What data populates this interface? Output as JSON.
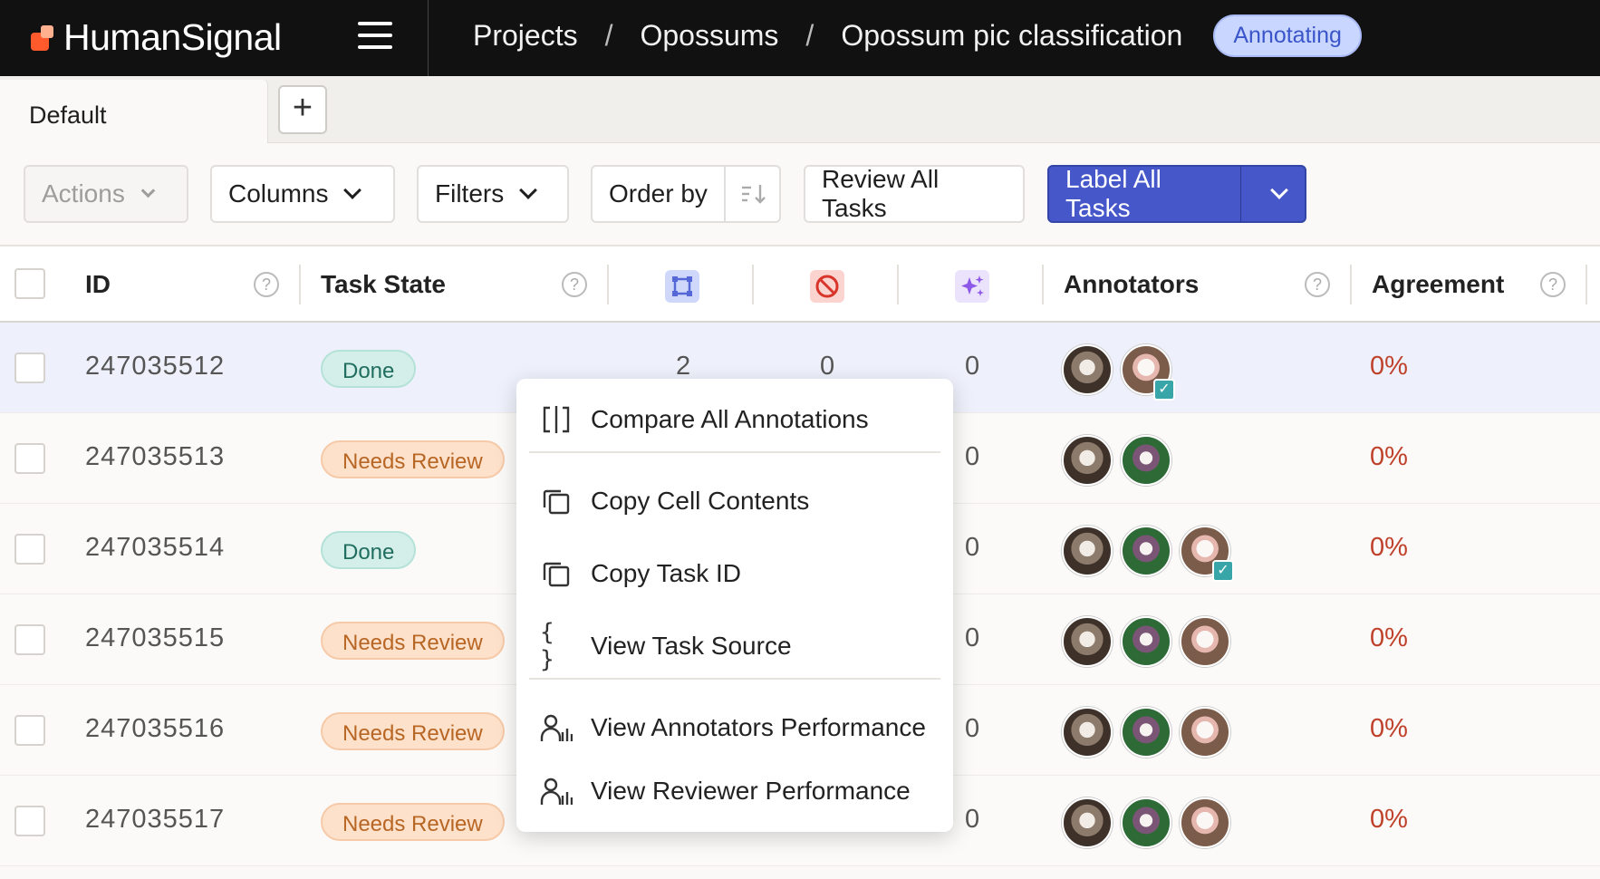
{
  "header": {
    "logo_text": "HumanSignal",
    "breadcrumbs": [
      "Projects",
      "Opossums",
      "Opossum pic classification"
    ],
    "separator": "/",
    "status": "Annotating"
  },
  "tabs": {
    "current": "Default",
    "add_label": "+"
  },
  "toolbar": {
    "actions": "Actions",
    "columns": "Columns",
    "filters": "Filters",
    "order_by": "Order by",
    "review_all": "Review All Tasks",
    "label_all": "Label All Tasks"
  },
  "table": {
    "headers": {
      "id": "ID",
      "task_state": "Task State",
      "annotators": "Annotators",
      "agreement": "Agreement"
    },
    "header_icons": [
      "annotations-count-icon",
      "cancelled-icon",
      "predictions-icon"
    ],
    "rows": [
      {
        "id": "247035512",
        "state": "Done",
        "state_kind": "done",
        "annotations": "2",
        "cancelled": "0",
        "predictions": "0",
        "avatars": [
          "a1",
          "a3"
        ],
        "agreement": "0%"
      },
      {
        "id": "247035513",
        "state": "Needs Review",
        "state_kind": "review",
        "annotations": "",
        "cancelled": "",
        "predictions": "0",
        "avatars": [
          "a1",
          "a2"
        ],
        "agreement": "0%"
      },
      {
        "id": "247035514",
        "state": "Done",
        "state_kind": "done",
        "annotations": "",
        "cancelled": "",
        "predictions": "0",
        "avatars": [
          "a1",
          "a2",
          "a3"
        ],
        "agreement": "0%"
      },
      {
        "id": "247035515",
        "state": "Needs Review",
        "state_kind": "review",
        "annotations": "",
        "cancelled": "",
        "predictions": "0",
        "avatars": [
          "a1",
          "a2",
          "a3"
        ],
        "agreement": "0%"
      },
      {
        "id": "247035516",
        "state": "Needs Review",
        "state_kind": "review",
        "annotations": "",
        "cancelled": "",
        "predictions": "0",
        "avatars": [
          "a1",
          "a2",
          "a3"
        ],
        "agreement": "0%"
      },
      {
        "id": "247035517",
        "state": "Needs Review",
        "state_kind": "review",
        "annotations": "",
        "cancelled": "",
        "predictions": "0",
        "avatars": [
          "a1",
          "a2",
          "a3"
        ],
        "agreement": "0%"
      }
    ]
  },
  "context_menu": {
    "compare": "Compare All Annotations",
    "copy_cell": "Copy Cell Contents",
    "copy_task_id": "Copy Task ID",
    "view_source": "View Task Source",
    "annotators_perf": "View Annotators Performance",
    "reviewer_perf": "View Reviewer Performance"
  },
  "colors": {
    "primary": "#4557c9",
    "agreement": "#c0412b",
    "done": "#d4efe9",
    "review": "#fde1cb"
  }
}
